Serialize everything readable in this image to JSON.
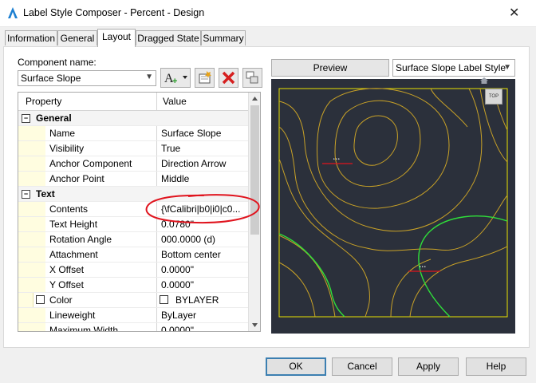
{
  "window": {
    "title": "Label Style Composer - Percent - Design",
    "close_glyph": "✕"
  },
  "tabs": [
    {
      "label": "Information"
    },
    {
      "label": "General"
    },
    {
      "label": "Layout"
    },
    {
      "label": "Dragged State"
    },
    {
      "label": "Summary"
    }
  ],
  "component": {
    "label": "Component name:",
    "value": "Surface Slope"
  },
  "grid": {
    "col_property": "Property",
    "col_value": "Value",
    "rows": [
      {
        "type": "cat",
        "name": "General"
      },
      {
        "type": "prop",
        "name": "Name",
        "value": "Surface Slope"
      },
      {
        "type": "prop",
        "name": "Visibility",
        "value": "True"
      },
      {
        "type": "prop",
        "name": "Anchor Component",
        "value": "Direction Arrow"
      },
      {
        "type": "prop",
        "name": "Anchor Point",
        "value": "Middle"
      },
      {
        "type": "cat",
        "name": "Text"
      },
      {
        "type": "prop",
        "name": "Contents",
        "value": "{\\fCalibri|b0|i0|c0..."
      },
      {
        "type": "prop",
        "name": "Text Height",
        "value": "0.0780\""
      },
      {
        "type": "prop",
        "name": "Rotation Angle",
        "value": "000.0000 (d)"
      },
      {
        "type": "prop",
        "name": "Attachment",
        "value": "Bottom center"
      },
      {
        "type": "prop",
        "name": "X Offset",
        "value": "0.0000\""
      },
      {
        "type": "prop",
        "name": "Y Offset",
        "value": "0.0000\""
      },
      {
        "type": "prop",
        "name": "Color",
        "value": "BYLAYER"
      },
      {
        "type": "prop",
        "name": "Lineweight",
        "value": "ByLayer"
      },
      {
        "type": "prop",
        "name": "Maximum Width",
        "value": "0.0000\""
      }
    ]
  },
  "preview": {
    "button": "Preview",
    "style_value": "Surface Slope Label Style",
    "viewcube": "TOP"
  },
  "buttons": {
    "ok": "OK",
    "cancel": "Cancel",
    "apply": "Apply",
    "help": "Help"
  },
  "colors": {
    "contour": "#c9a227",
    "green": "#2fe03a",
    "annotation": "#e0141e",
    "preview_bg": "#2b303b",
    "frame": "#e8e200"
  }
}
